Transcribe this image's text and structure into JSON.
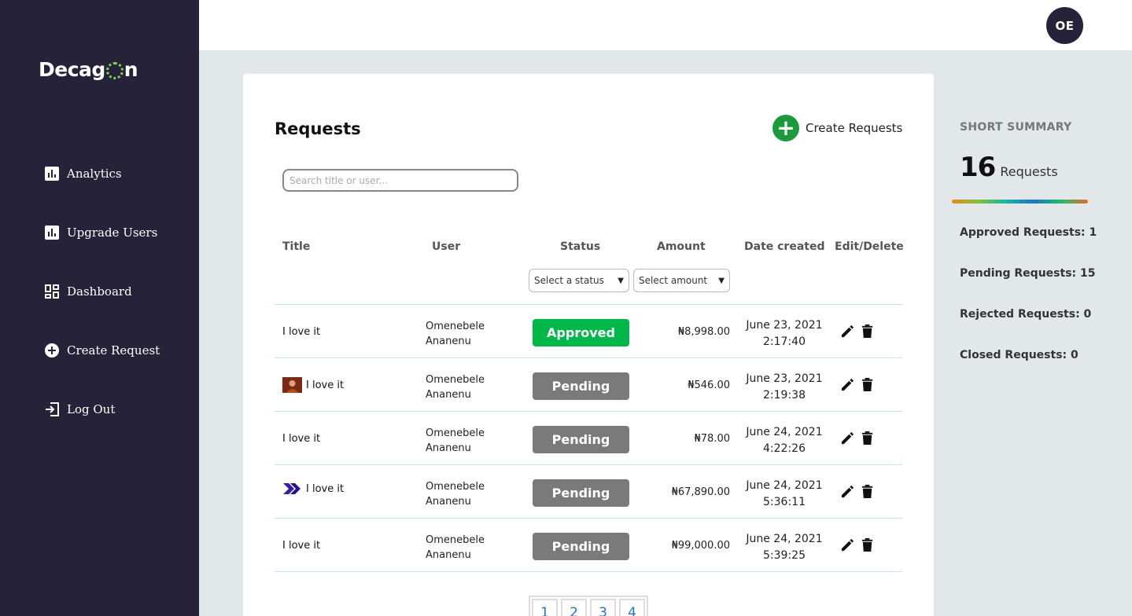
{
  "brand": {
    "name_prefix": "Decag",
    "name_suffix": "n"
  },
  "sidebar": {
    "items": [
      {
        "label": "Analytics",
        "icon": "bar-chart-icon"
      },
      {
        "label": "Upgrade Users",
        "icon": "bar-chart-icon"
      },
      {
        "label": "Dashboard",
        "icon": "dashboard-grid-icon"
      },
      {
        "label": "Create Request",
        "icon": "plus-circle-icon"
      },
      {
        "label": "Log Out",
        "icon": "logout-icon"
      }
    ]
  },
  "header": {
    "avatar_initials": "OE"
  },
  "main": {
    "title": "Requests",
    "create_label": "Create Requests",
    "search_placeholder": "Search title or user...",
    "columns": [
      "Title",
      "User",
      "Status",
      "Amount",
      "Date created",
      "Edit/Delete"
    ],
    "filters": {
      "status_placeholder": "Select a status",
      "amount_placeholder": "Select amount"
    },
    "rows": [
      {
        "title": "I love it",
        "thumb": "",
        "user_first": "Omenebele",
        "user_last": "Ananenu",
        "status": "Approved",
        "amount": "₦8,998.00",
        "date": "June 23, 2021",
        "time": "2:17:40"
      },
      {
        "title": "I love it",
        "thumb": "photo",
        "user_first": "Omenebele",
        "user_last": "Ananenu",
        "status": "Pending",
        "amount": "₦546.00",
        "date": "June 23, 2021",
        "time": "2:19:38"
      },
      {
        "title": "I love it",
        "thumb": "",
        "user_first": "Omenebele",
        "user_last": "Ananenu",
        "status": "Pending",
        "amount": "₦78.00",
        "date": "June 24, 2021",
        "time": "4:22:26"
      },
      {
        "title": "I love it",
        "thumb": "chevrons",
        "user_first": "Omenebele",
        "user_last": "Ananenu",
        "status": "Pending",
        "amount": "₦67,890.00",
        "date": "June 24, 2021",
        "time": "5:36:11"
      },
      {
        "title": "I love it",
        "thumb": "",
        "user_first": "Omenebele",
        "user_last": "Ananenu",
        "status": "Pending",
        "amount": "₦99,000.00",
        "date": "June 24, 2021",
        "time": "5:39:25"
      }
    ],
    "pages": [
      "1",
      "2",
      "3",
      "4"
    ]
  },
  "summary": {
    "title": "SHORT SUMMARY",
    "total_count": "16",
    "total_label": "Requests",
    "stats": [
      "Approved Requests: 1",
      "Pending Requests: 15",
      "Rejected Requests: 0",
      "Closed Requests: 0"
    ]
  },
  "colors": {
    "sidebar": "#25223a",
    "approved": "#00b84a",
    "pending": "#7a7a7a",
    "background": "#e2e7ea"
  }
}
